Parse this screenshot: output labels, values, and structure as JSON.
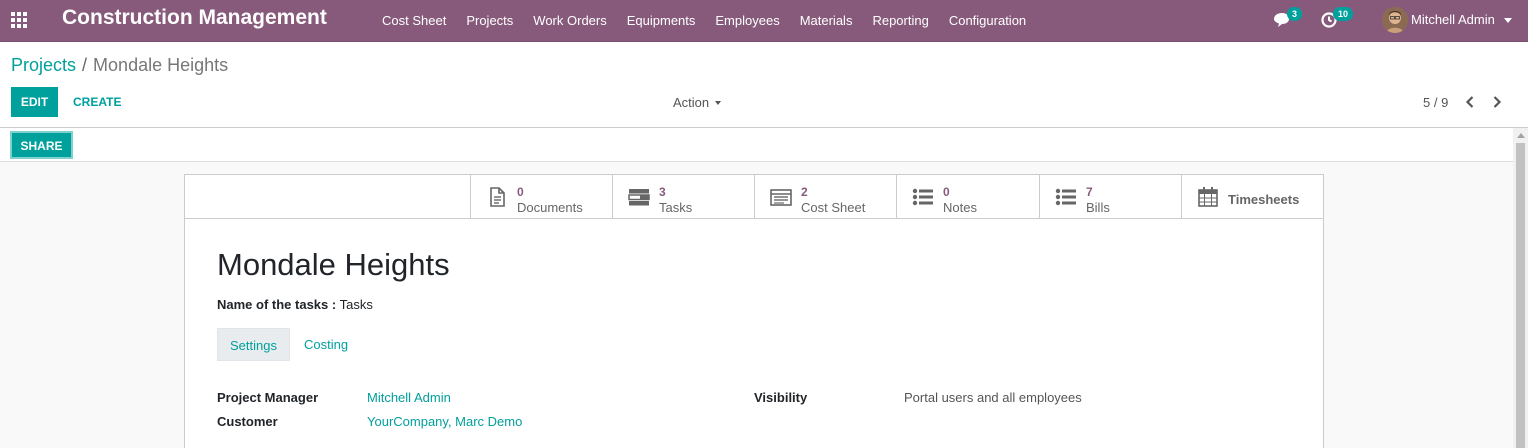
{
  "navbar": {
    "app_title": "Construction Management",
    "menu": [
      "Cost Sheet",
      "Projects",
      "Work Orders",
      "Equipments",
      "Employees",
      "Materials",
      "Reporting",
      "Configuration"
    ],
    "messages_count": "3",
    "activities_count": "10",
    "user_name": "Mitchell Admin",
    "color": "#875a7b"
  },
  "breadcrumb": {
    "parent": "Projects",
    "separator": "/",
    "current": "Mondale Heights"
  },
  "toolbar": {
    "edit_label": "EDIT",
    "create_label": "CREATE",
    "action_label": "Action",
    "pager": "5 / 9",
    "share_label": "SHARE"
  },
  "smart_buttons": [
    {
      "icon": "file-icon",
      "count": "0",
      "label": "Documents"
    },
    {
      "icon": "tasks-icon",
      "count": "3",
      "label": "Tasks"
    },
    {
      "icon": "cost-sheet-icon",
      "count": "2",
      "label": "Cost Sheet"
    },
    {
      "icon": "list-icon",
      "count": "0",
      "label": "Notes"
    },
    {
      "icon": "list-icon",
      "count": "7",
      "label": "Bills"
    },
    {
      "icon": "calendar-icon",
      "count": "",
      "label": "Timesheets"
    }
  ],
  "form": {
    "title": "Mondale Heights",
    "tasks_name_label": "Name of the tasks :",
    "tasks_name_value": "Tasks",
    "tabs": [
      "Settings",
      "Costing"
    ],
    "project_manager_label": "Project Manager",
    "project_manager_value": "Mitchell Admin",
    "customer_label": "Customer",
    "customer_value": "YourCompany, Marc Demo",
    "visibility_label": "Visibility",
    "visibility_value": "Portal users and all employees"
  },
  "colors": {
    "accent": "#00a09d",
    "brand": "#875a7b"
  }
}
